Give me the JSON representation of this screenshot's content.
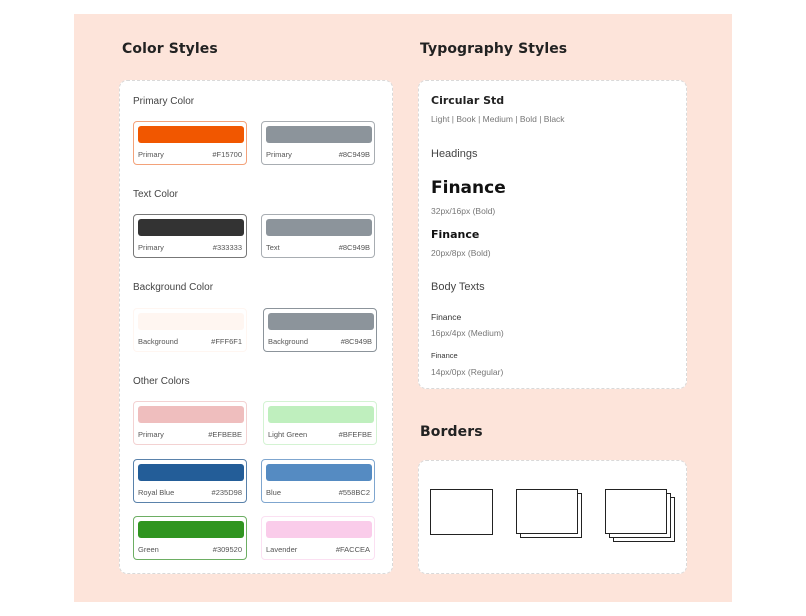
{
  "color_styles": {
    "title": "Color Styles",
    "groups": {
      "primary": {
        "title": "Primary Color",
        "swatches": [
          {
            "name": "Primary",
            "hex": "#F15700",
            "color": "#F15700"
          },
          {
            "name": "Primary",
            "hex": "#8C949B",
            "color": "#8C949B"
          }
        ]
      },
      "text": {
        "title": "Text Color",
        "swatches": [
          {
            "name": "Primary",
            "hex": "#333333",
            "color": "#333333"
          },
          {
            "name": "Text",
            "hex": "#8C949B",
            "color": "#8C949B"
          }
        ]
      },
      "background": {
        "title": "Background Color",
        "swatches": [
          {
            "name": "Background",
            "hex": "#FFF6F1",
            "color": "#FFF6F1"
          },
          {
            "name": "Background",
            "hex": "#8C949B",
            "color": "#8C949B"
          }
        ]
      },
      "other": {
        "title": "Other Colors",
        "swatches": [
          {
            "name": "Primary",
            "hex": "#EFBEBE",
            "color": "#EFBEBE"
          },
          {
            "name": "Light Green",
            "hex": "#BFEFBE",
            "color": "#BFEFBE"
          },
          {
            "name": "Royal Blue",
            "hex": "#235D98",
            "color": "#235D98"
          },
          {
            "name": "Blue",
            "hex": "#558BC2",
            "color": "#558BC2"
          },
          {
            "name": "Green",
            "hex": "#309520",
            "color": "#309520"
          },
          {
            "name": "Lavender",
            "hex": "#FACCEA",
            "color": "#FACCEA"
          }
        ]
      }
    }
  },
  "typography": {
    "title": "Typography Styles",
    "font_name": "Circular Std",
    "weights": "Light | Book | Medium | Bold | Black",
    "headings_label": "Headings",
    "h1_sample": "Finance",
    "h1_spec": "32px/16px (Bold)",
    "h2_sample": "Finance",
    "h2_spec": "20px/8px (Bold)",
    "body_label": "Body Texts",
    "body1_sample": "Finance",
    "body1_spec": "16px/4px (Medium)",
    "body2_sample": "Finance",
    "body2_spec": "14px/0px (Regular)"
  },
  "borders": {
    "title": "Borders"
  }
}
